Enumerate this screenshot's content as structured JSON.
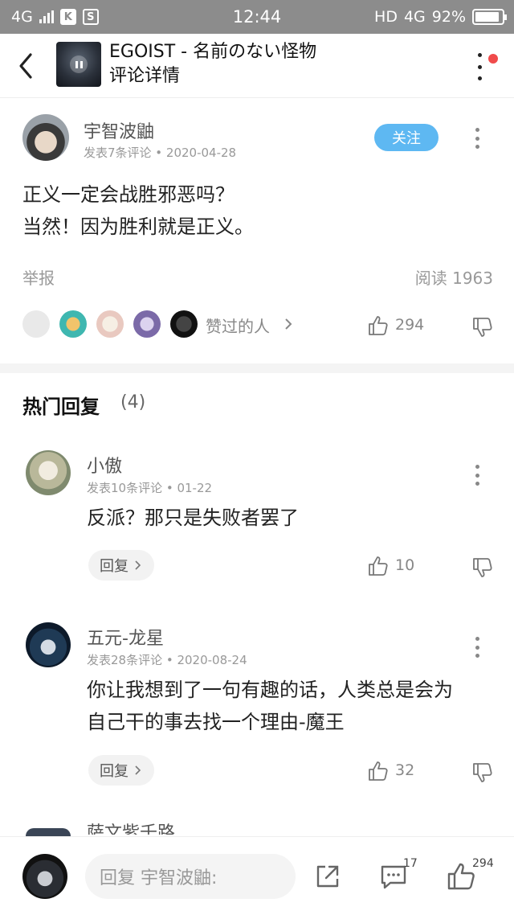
{
  "status_bar": {
    "network_left": "4G",
    "k_icon_label": "K",
    "s_icon_label": "S",
    "time": "12:44",
    "hd": "HD",
    "network_right": "4G",
    "battery": "92%",
    "battery_level": 0.92
  },
  "header": {
    "song_title": "EGOIST - 名前のない怪物",
    "page_title": "评论详情"
  },
  "comment": {
    "author": "宇智波鼬",
    "meta": "发表7条评论 • 2020-04-28",
    "follow_label": "关注",
    "lines": [
      "正义一定会战胜邪恶吗？",
      "当然！因为胜利就是正义。"
    ],
    "report_label": "举报",
    "reads": "阅读 1963",
    "likers_label": "赞过的人",
    "like_count": "294"
  },
  "hot_replies": {
    "title": "热门回复",
    "count": "(4)",
    "items": [
      {
        "author": "小傲",
        "meta": "发表10条评论 • 01-22",
        "lines": [
          "反派？那只是失败者罢了"
        ],
        "reply_label": "回复",
        "like_count": "10"
      },
      {
        "author": "五元-龙星",
        "meta": "发表28条评论 • 2020-08-24",
        "lines": [
          "你让我想到了一句有趣的话，人类总是会为",
          "自己干的事去找一个理由-魔王"
        ],
        "reply_label": "回复",
        "like_count": "32"
      }
    ],
    "partial_author": "萨文紫千路"
  },
  "bottom": {
    "input_placeholder": "回复 宇智波鼬:",
    "comment_count": "17",
    "like_count": "294"
  },
  "colors": {
    "status_bar": "#8c8c8c",
    "follow_button": "#5eb8f2",
    "notify_dot": "#f04b4b"
  }
}
